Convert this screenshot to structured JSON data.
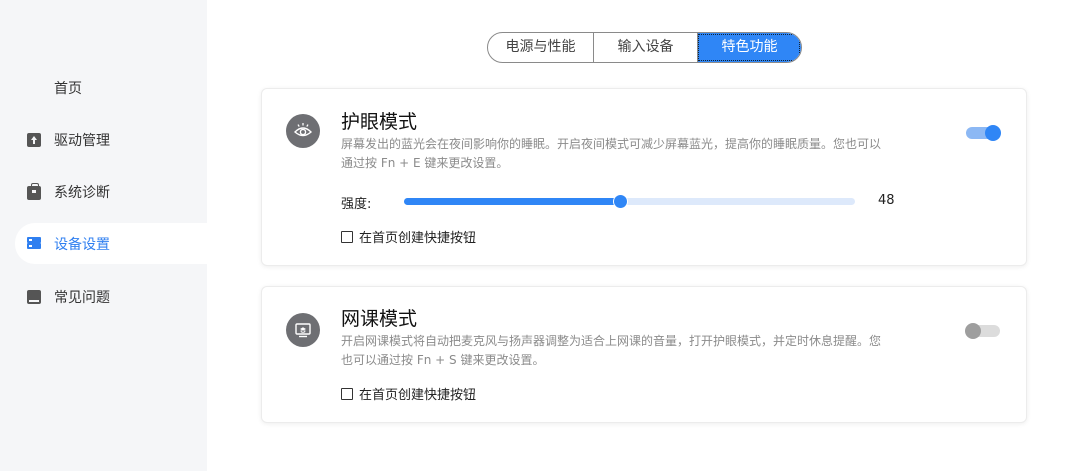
{
  "sidebar": {
    "items": [
      {
        "label": "首页",
        "icon": "home-grid-icon"
      },
      {
        "label": "驱动管理",
        "icon": "driver-icon"
      },
      {
        "label": "系统诊断",
        "icon": "toolbox-icon"
      },
      {
        "label": "设备设置",
        "icon": "device-settings-icon",
        "active": true
      },
      {
        "label": "常见问题",
        "icon": "book-icon"
      }
    ]
  },
  "tabs": [
    {
      "label": "电源与性能"
    },
    {
      "label": "输入设备"
    },
    {
      "label": "特色功能",
      "active": true
    }
  ],
  "eye_mode": {
    "title": "护眼模式",
    "description_line1": "屏幕发出的蓝光会在夜间影响你的睡眠。开启夜间模式可减少屏幕蓝光，提高你的睡眠质量。您也可以",
    "description_line2": "通过按 Fn + E 键来更改设置。",
    "enabled": true,
    "strength_label": "强度:",
    "strength_value": "48",
    "strength_fraction": 0.48,
    "shortcut_label": "在首页创建快捷按钮",
    "shortcut_checked": false,
    "icon": "eye-icon"
  },
  "class_mode": {
    "title": "网课模式",
    "description_line1": "开启网课模式将自动把麦克风与扬声器调整为适合上网课的音量，打开护眼模式，并定时休息提醒。您",
    "description_line2": "也可以通过按 Fn + S 键来更改设置。",
    "enabled": false,
    "shortcut_label": "在首页创建快捷按钮",
    "shortcut_checked": false,
    "icon": "online-class-icon"
  },
  "colors": {
    "accent": "#2f86f6",
    "sidebar_bg": "#f5f6f8",
    "icon_circle": "#6e6f73"
  }
}
